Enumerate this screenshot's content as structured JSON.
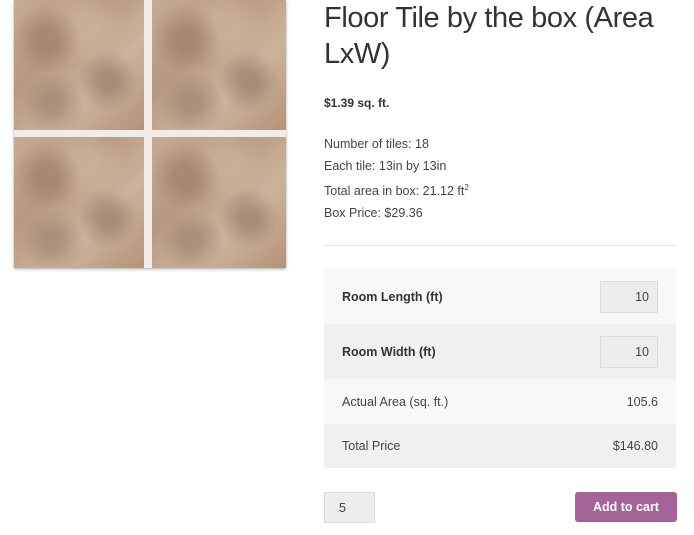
{
  "product": {
    "title": "Floor Tile by the box (Area LxW)",
    "price": "$1.39 sq. ft.",
    "image_alt": "floor-tile-product-image"
  },
  "details": {
    "tiles": "Number of tiles: 18",
    "tile_size": "Each tile: 13in by 13in",
    "area_prefix": "Total area in box: 21.12 ft",
    "area_exp": "2",
    "box_price": "Box Price: $29.36"
  },
  "calculator": {
    "length_label": "Room Length (ft)",
    "length_value": "10",
    "width_label": "Room Width (ft)",
    "width_value": "10",
    "area_label": "Actual Area (sq. ft.)",
    "area_value": "105.6",
    "total_label": "Total Price",
    "total_value": "$146.80"
  },
  "cart": {
    "quantity": "5",
    "button_label": "Add to cart",
    "button_color": "#a46497"
  }
}
